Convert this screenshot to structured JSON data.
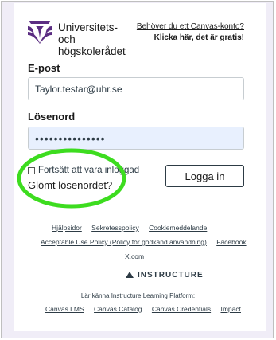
{
  "brand": {
    "name_line1": "Universitets- och",
    "name_line2": "högskolerådet"
  },
  "signup": {
    "question": "Behöver du ett Canvas-konto?",
    "action": "Klicka här, det är gratis!"
  },
  "email": {
    "label": "E-post",
    "value": "Taylor.testar@uhr.se"
  },
  "password": {
    "label": "Lösenord",
    "value": "•••••••••••••••"
  },
  "remember": {
    "label": "Fortsätt att vara inloggad",
    "checked": false
  },
  "forgot": {
    "label": "Glömt lösenordet?"
  },
  "login_button": {
    "label": "Logga in"
  },
  "annotation": {
    "color": "#3ddc1f"
  },
  "footer": {
    "row1": [
      "Hjälpsidor",
      "Sekretesspolicy",
      "Cookiemeddelande"
    ],
    "row2": [
      "Acceptable Use Policy (Policy för godkänd användning)",
      "Facebook"
    ],
    "row3": [
      "X.com"
    ],
    "instructure": "INSTRUCTURE",
    "meet": "Lär känna Instructure Learning Platform:",
    "row4": [
      "Canvas LMS",
      "Canvas Catalog",
      "Canvas Credentials",
      "Impact"
    ]
  },
  "colors": {
    "brand": "#5b2d82",
    "frame": "#f0edf7",
    "autofill": "#e8f0fe"
  }
}
